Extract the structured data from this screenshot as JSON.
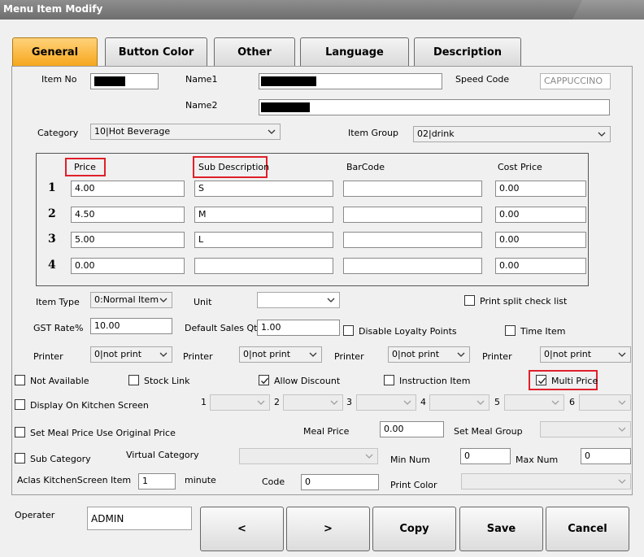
{
  "window": {
    "title": "Menu Item Modify"
  },
  "tabs": [
    "General",
    "Button Color",
    "Other",
    "Language",
    "Description"
  ],
  "form": {
    "item_no_label": "Item No",
    "name1_label": "Name1",
    "name2_label": "Name2",
    "speed_code_label": "Speed Code",
    "speed_code_value": "CAPPUCCINO",
    "category_label": "Category",
    "category_value": "10|Hot Beverage",
    "item_group_label": "Item Group",
    "item_group_value": "02|drink"
  },
  "price_table": {
    "headers": {
      "price": "Price",
      "sub_description": "Sub Description",
      "barcode": "BarCode",
      "cost_price": "Cost Price"
    },
    "rows": [
      {
        "num": "1",
        "price": "4.00",
        "sub_description": "S",
        "barcode": "",
        "cost_price": "0.00"
      },
      {
        "num": "2",
        "price": "4.50",
        "sub_description": "M",
        "barcode": "",
        "cost_price": "0.00"
      },
      {
        "num": "3",
        "price": "5.00",
        "sub_description": "L",
        "barcode": "",
        "cost_price": "0.00"
      },
      {
        "num": "4",
        "price": "0.00",
        "sub_description": "",
        "barcode": "",
        "cost_price": "0.00"
      }
    ]
  },
  "item_type": {
    "label": "Item Type",
    "value": "0:Normal Item"
  },
  "unit": {
    "label": "Unit",
    "value": ""
  },
  "print_split_check_list": {
    "label": "Print split check list",
    "checked": false
  },
  "gst": {
    "label": "GST Rate%",
    "value": "10.00"
  },
  "default_sales_qty": {
    "label": "Default Sales Qty",
    "value": "1.00"
  },
  "disable_loyalty_points": {
    "label": "Disable Loyalty Points",
    "checked": false
  },
  "time_item": {
    "label": "Time Item",
    "checked": false
  },
  "printers": [
    {
      "label": "Printer",
      "value": "0|not print"
    },
    {
      "label": "Printer",
      "value": "0|not print"
    },
    {
      "label": "Printer",
      "value": "0|not print"
    },
    {
      "label": "Printer",
      "value": "0|not print"
    }
  ],
  "checks": {
    "not_available": {
      "label": "Not Available",
      "checked": false
    },
    "stock_link": {
      "label": "Stock Link",
      "checked": false
    },
    "allow_discount": {
      "label": "Allow Discount",
      "checked": true
    },
    "instruction_item": {
      "label": "Instruction Item",
      "checked": false
    },
    "multi_price": {
      "label": "Multi Price",
      "checked": true
    },
    "display_on_kitchen": {
      "label": "Display On Kitchen Screen",
      "checked": false
    },
    "set_meal_original_price": {
      "label": "Set Meal Price Use Original Price",
      "checked": false
    },
    "sub_category": {
      "label": "Sub Category",
      "checked": false
    }
  },
  "kitchen_screens": [
    "1",
    "2",
    "3",
    "4",
    "5",
    "6"
  ],
  "meal_price": {
    "label": "Meal Price",
    "value": "0.00"
  },
  "set_meal_group": {
    "label": "Set Meal Group",
    "value": ""
  },
  "virtual_category": {
    "label": "Virtual Category",
    "value": ""
  },
  "min_num": {
    "label": "Min Num",
    "value": "0"
  },
  "max_num": {
    "label": "Max Num",
    "value": "0"
  },
  "aclas": {
    "label": "Aclas KitchenScreen Item",
    "value": "1",
    "unit": "minute"
  },
  "code": {
    "label": "Code",
    "value": "0"
  },
  "print_color": {
    "label": "Print Color",
    "value": ""
  },
  "operator": {
    "label": "Operater",
    "value": "ADMIN"
  },
  "buttons": {
    "prev": "<",
    "next": ">",
    "copy": "Copy",
    "save": "Save",
    "cancel": "Cancel"
  }
}
